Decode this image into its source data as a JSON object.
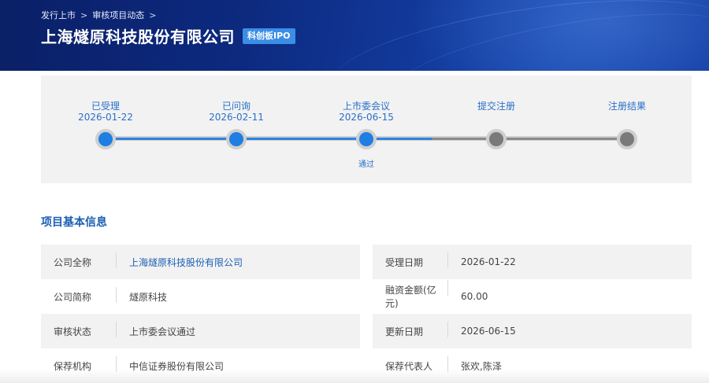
{
  "header": {
    "breadcrumb": [
      "发行上市",
      "审核项目动态"
    ],
    "breadcrumb_sep": ">",
    "company_title": "上海燧原科技股份有限公司",
    "board_badge": "科创板IPO"
  },
  "progress": {
    "steps": [
      {
        "label": "已受理",
        "date": "2026-01-22",
        "state": "done",
        "note": ""
      },
      {
        "label": "已问询",
        "date": "2026-02-11",
        "state": "done",
        "note": ""
      },
      {
        "label": "上市委会议",
        "date": "2026-06-15",
        "state": "done",
        "note": "通过"
      },
      {
        "label": "提交注册",
        "date": "",
        "state": "todo",
        "note": ""
      },
      {
        "label": "注册结果",
        "date": "",
        "state": "todo",
        "note": ""
      }
    ],
    "colors": {
      "done": "#1f7ee3",
      "todo": "#7a7a7a",
      "track": "#cfcfcf"
    }
  },
  "info": {
    "section_title": "项目基本信息",
    "rows": [
      [
        {
          "label": "公司全称",
          "value": "上海燧原科技股份有限公司",
          "link": true
        },
        {
          "label": "受理日期",
          "value": "2026-01-22",
          "link": false
        }
      ],
      [
        {
          "label": "公司简称",
          "value": "燧原科技",
          "link": false
        },
        {
          "label": "融资金额(亿元)",
          "value": "60.00",
          "link": false
        }
      ],
      [
        {
          "label": "审核状态",
          "value": "上市委会议通过",
          "link": false
        },
        {
          "label": "更新日期",
          "value": "2026-06-15",
          "link": false
        }
      ],
      [
        {
          "label": "保荐机构",
          "value": "中信证券股份有限公司",
          "link": false
        },
        {
          "label": "保荐代表人",
          "value": "张欢,陈泽",
          "link": false
        }
      ]
    ]
  }
}
